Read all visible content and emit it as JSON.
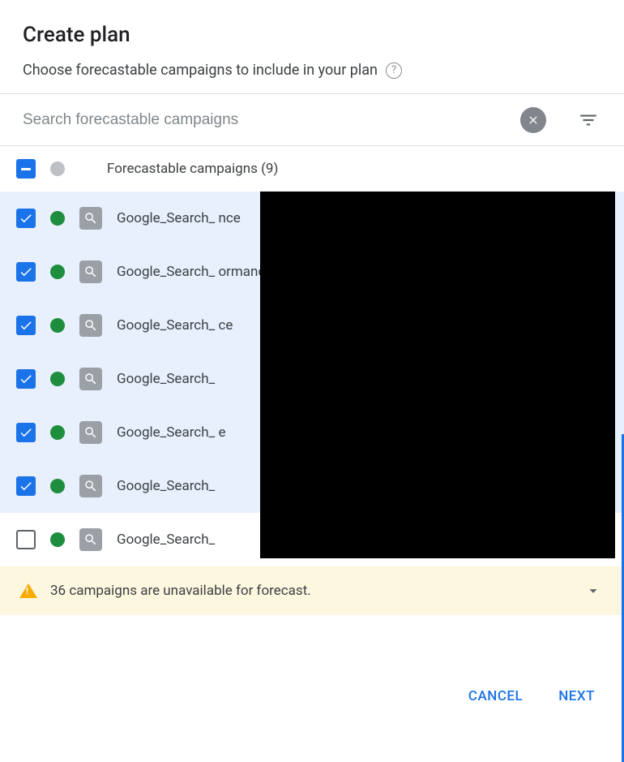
{
  "header": {
    "title": "Create plan",
    "subtitle": "Choose forecastable campaigns to include in your plan"
  },
  "search": {
    "placeholder": "Search forecastable campaigns"
  },
  "listHeader": {
    "label": "Forecastable campaigns (9)"
  },
  "rows": [
    {
      "checked": true,
      "name": "Google_Search_\nnce"
    },
    {
      "checked": true,
      "name": "Google_Search_\normance"
    },
    {
      "checked": true,
      "name": "Google_Search_\nce"
    },
    {
      "checked": true,
      "name": "Google_Search_"
    },
    {
      "checked": true,
      "name": "Google_Search_\ne"
    },
    {
      "checked": true,
      "name": "Google_Search_"
    },
    {
      "checked": false,
      "name": "Google_Search_"
    }
  ],
  "notice": {
    "text": "36 campaigns are unavailable for forecast."
  },
  "footer": {
    "cancel": "CANCEL",
    "next": "NEXT"
  }
}
